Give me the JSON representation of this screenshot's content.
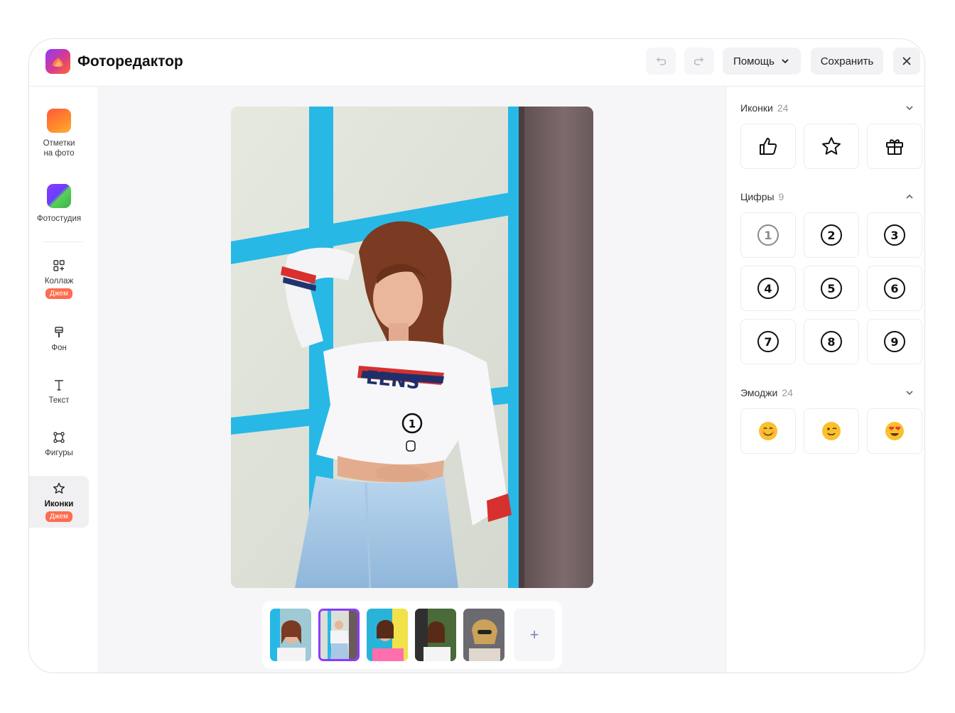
{
  "app": {
    "title": "Фоторедактор"
  },
  "header": {
    "undo_icon": "undo-icon",
    "redo_icon": "redo-icon",
    "help_label": "Помощь",
    "save_label": "Сохранить",
    "close_icon": "close-icon"
  },
  "sidebar": {
    "items": [
      {
        "label": "Отметки\nна фото",
        "line1": "Отметки",
        "line2": "на фото",
        "icon": "photo-marks-app-icon"
      },
      {
        "label": "Фотостудия",
        "icon": "photo-studio-app-icon"
      },
      {
        "label": "Коллаж",
        "icon": "collage-icon",
        "badge": "Джем"
      },
      {
        "label": "Фон",
        "icon": "background-brush-icon"
      },
      {
        "label": "Текст",
        "icon": "text-icon"
      },
      {
        "label": "Фигуры",
        "icon": "shapes-icon"
      },
      {
        "label": "Иконки",
        "icon": "star-icon",
        "badge": "Джем",
        "active": true
      }
    ]
  },
  "canvas": {
    "photo_overlay_number": "1",
    "thumbnails_count_visible": 5,
    "selected_thumbnail": 2,
    "add_label": "+"
  },
  "panel": {
    "sections": [
      {
        "title": "Иконки",
        "count": "24",
        "expanded": false,
        "icons": [
          "thumbs-up-icon",
          "star-icon",
          "gift-icon"
        ]
      },
      {
        "title": "Цифры",
        "count": "9",
        "expanded": true,
        "numbers": [
          "1",
          "2",
          "3",
          "4",
          "5",
          "6",
          "7",
          "8",
          "9"
        ]
      },
      {
        "title": "Эмоджи",
        "count": "24",
        "expanded": false,
        "icons": [
          "smiling-emoji",
          "winking-emoji",
          "heart-eyes-emoji"
        ]
      }
    ]
  },
  "colors": {
    "accent": "#8a3cff",
    "badge": "#ff6b4f",
    "canvas_bg": "#f6f6f8"
  }
}
